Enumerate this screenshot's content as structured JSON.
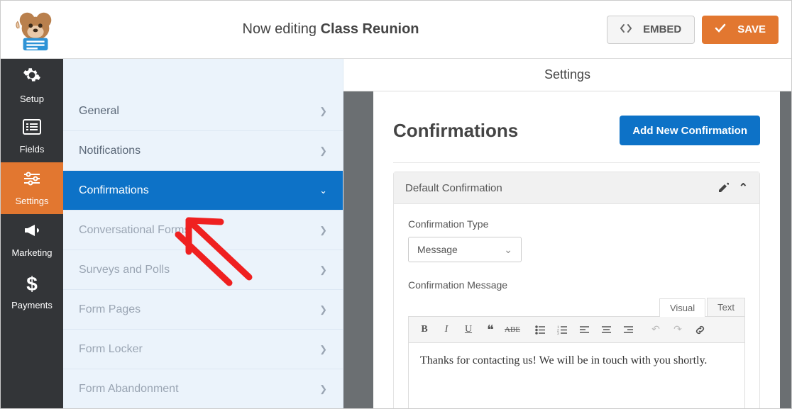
{
  "header": {
    "editing_prefix": "Now editing ",
    "form_name": "Class Reunion",
    "embed_label": "EMBED",
    "save_label": "SAVE"
  },
  "rail": {
    "items": [
      {
        "label": "Setup"
      },
      {
        "label": "Fields"
      },
      {
        "label": "Settings"
      },
      {
        "label": "Marketing"
      },
      {
        "label": "Payments"
      }
    ],
    "active_index": 2
  },
  "settings_header": "Settings",
  "submenu": {
    "items": [
      {
        "label": "General",
        "active": false,
        "dim": false
      },
      {
        "label": "Notifications",
        "active": false,
        "dim": false
      },
      {
        "label": "Confirmations",
        "active": true,
        "dim": false
      },
      {
        "label": "Conversational Forms",
        "active": false,
        "dim": true
      },
      {
        "label": "Surveys and Polls",
        "active": false,
        "dim": true
      },
      {
        "label": "Form Pages",
        "active": false,
        "dim": true
      },
      {
        "label": "Form Locker",
        "active": false,
        "dim": true
      },
      {
        "label": "Form Abandonment",
        "active": false,
        "dim": true
      }
    ]
  },
  "panel": {
    "title": "Confirmations",
    "add_button": "Add New Confirmation",
    "card_title": "Default Confirmation",
    "type_label": "Confirmation Type",
    "type_value": "Message",
    "message_label": "Confirmation Message",
    "tabs": {
      "visual": "Visual",
      "text": "Text"
    },
    "editor_content": "Thanks for contacting us! We will be in touch with you shortly."
  }
}
